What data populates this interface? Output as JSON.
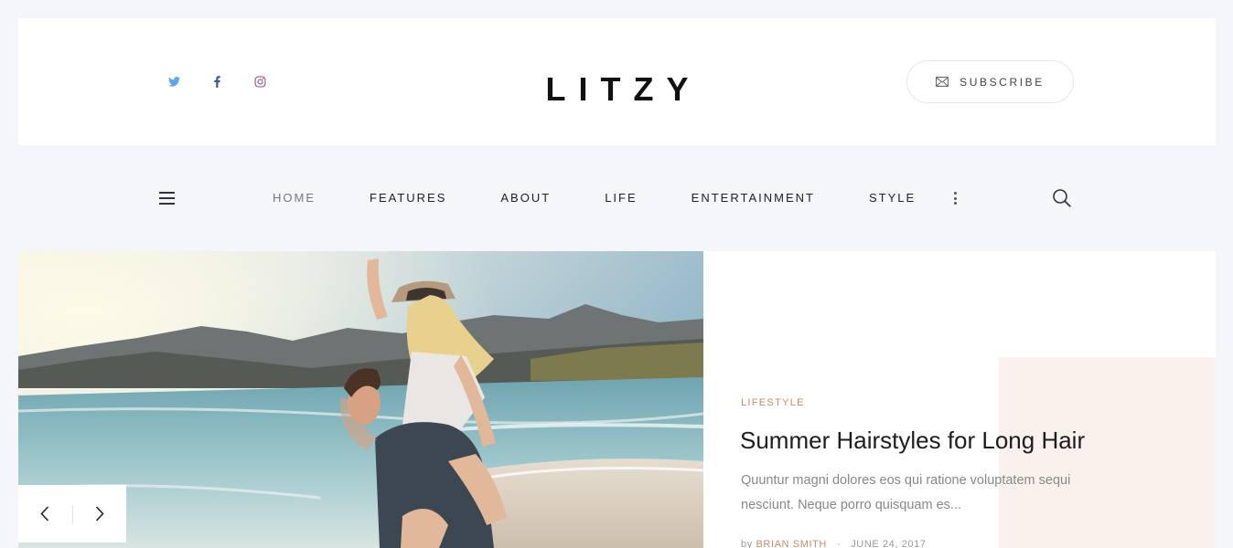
{
  "header": {
    "logo": "LITZY",
    "subscribe_label": "SUBSCRIBE",
    "socials": [
      {
        "icon": "twitter-icon",
        "color": "#5aa9e6"
      },
      {
        "icon": "facebook-icon",
        "color": "#3b5998"
      },
      {
        "icon": "instagram-icon",
        "color": "#9b5c8a"
      }
    ]
  },
  "nav": {
    "items": [
      "HOME",
      "FEATURES",
      "ABOUT",
      "LIFE",
      "ENTERTAINMENT",
      "STYLE"
    ],
    "active": "HOME"
  },
  "featured": {
    "category": "LIFESTYLE",
    "title": "Summer Hairstyles for Long Hair",
    "excerpt": "Quuntur magni dolores eos qui ratione voluptatem sequi nesciunt. Neque porro quisquam es...",
    "by": "by",
    "author": "BRIAN SMITH",
    "date": "JUNE 24, 2017"
  },
  "colors": {
    "accent": "#c98a6a",
    "accent_block": "#faf1ec",
    "background": "#f5f6fa"
  }
}
